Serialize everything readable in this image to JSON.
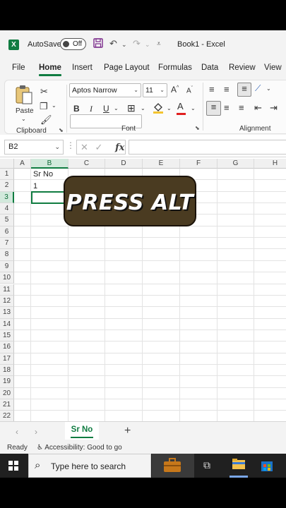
{
  "title_bar": {
    "app_badge": "X",
    "autosave_label": "AutoSave",
    "autosave_state": "Off",
    "document_title": "Book1 - Excel"
  },
  "tabs": [
    "File",
    "Home",
    "Insert",
    "Page Layout",
    "Formulas",
    "Data",
    "Review",
    "View"
  ],
  "active_tab": "Home",
  "ribbon": {
    "paste_label": "Paste",
    "clipboard_label": "Clipboard",
    "font_label": "Font",
    "alignment_label": "Alignment",
    "font_name": "Aptos Narrow",
    "font_size": "11",
    "bold": "B",
    "italic": "I",
    "underline": "U",
    "grow_font": "A",
    "shrink_font": "A",
    "font_color_letter": "A",
    "fill_color": "#f4c430",
    "font_color": "#e02020"
  },
  "formula_bar": {
    "name_box": "B2",
    "fx": "fx",
    "formula": ""
  },
  "grid": {
    "columns": [
      "A",
      "B",
      "C",
      "D",
      "E",
      "F",
      "G",
      "H"
    ],
    "rows": [
      "1",
      "2",
      "3",
      "4",
      "5",
      "6",
      "7",
      "8",
      "9",
      "10",
      "11",
      "12",
      "13",
      "14",
      "15",
      "16",
      "17",
      "18",
      "19",
      "20",
      "21",
      "22"
    ],
    "selected_column": "B",
    "selected_row": "3",
    "cell_b1": "Sr No",
    "cell_b2": "1"
  },
  "overlay_text": "PRESS ALT",
  "sheet_bar": {
    "sheet_name": "Sr No",
    "add_sheet": "+"
  },
  "status_bar": {
    "ready": "Ready",
    "accessibility": "Accessibility: Good to go"
  },
  "taskbar": {
    "search_placeholder": "Type here to search"
  },
  "colors": {
    "excel_green": "#107c41",
    "overlay_bg": "#4a3b21"
  }
}
